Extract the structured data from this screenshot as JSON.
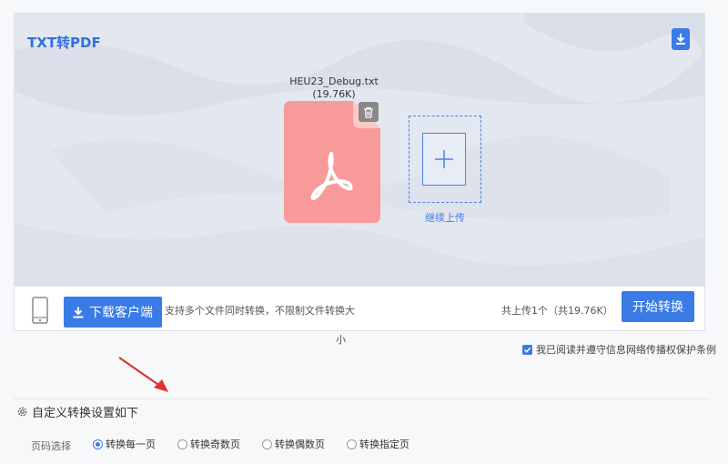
{
  "app": {
    "title": "TXT转PDF"
  },
  "file": {
    "name": "HEU23_Debug.txt",
    "size": "(19.76K)"
  },
  "upload": {
    "label": "继续上传"
  },
  "bar": {
    "client_button": "下载客户端",
    "support_text": "支持多个文件同时转换，不限制文件转换大",
    "overflow_char": "小",
    "count_text": "共上传1个（共19.76K）",
    "start_button": "开始转换"
  },
  "agreement": {
    "text": "我已阅读并遵守信息网络传播权保护条例",
    "checked": true
  },
  "settings": {
    "title": "自定义转换设置如下",
    "page_select_label": "页码选择",
    "options": [
      {
        "label": "转换每一页",
        "selected": true
      },
      {
        "label": "转换奇数页",
        "selected": false
      },
      {
        "label": "转换偶数页",
        "selected": false
      },
      {
        "label": "转换指定页",
        "selected": false
      }
    ]
  },
  "colors": {
    "accent": "#3a7be6",
    "file_card": "#f79a99",
    "annotation_arrow": "#e0332f"
  },
  "icons": [
    "download-icon",
    "trash-icon",
    "pdf-icon",
    "plus-icon",
    "phone-icon",
    "gear-icon",
    "check-icon"
  ]
}
